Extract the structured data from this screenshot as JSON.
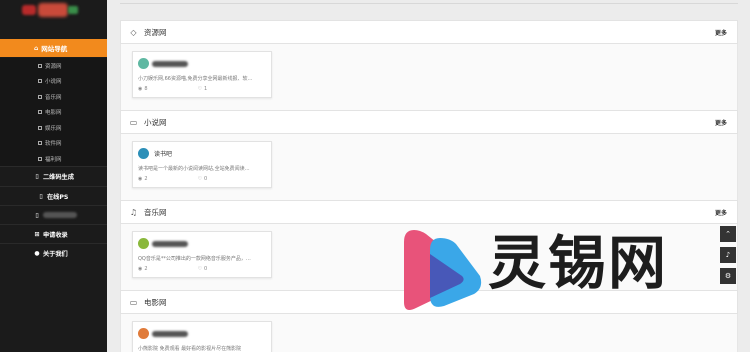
{
  "sidebar": {
    "active_item": {
      "icon": "home-icon",
      "label": "网站导航"
    },
    "subitems": [
      "资源网",
      "小说网",
      "音乐网",
      "电影网",
      "娱乐网",
      "软件网",
      "福利网"
    ],
    "items": [
      {
        "icon": "qrcode-icon",
        "label": "二维码生成"
      },
      {
        "icon": "image-icon",
        "label": "在线PS"
      },
      {
        "icon": "file-icon",
        "label": ""
      },
      {
        "icon": "plus-square-icon",
        "label": "申请收录"
      },
      {
        "icon": "info-icon",
        "label": "关于我们"
      }
    ]
  },
  "sections": [
    {
      "icon": "diamond-icon",
      "title": "资源网",
      "more": "更多",
      "card": {
        "name": "",
        "desc": "小刀娱乐网,66资源喵,免费分享全网最新线报、软…",
        "views": "8",
        "likes": "1"
      }
    },
    {
      "icon": "file-o-icon",
      "title": "小说网",
      "more": "更多",
      "card": {
        "name": "读书吧",
        "desc": "读书吧是一个最新的小说阅读网站,全站免费阅读…",
        "views": "2",
        "likes": "0"
      }
    },
    {
      "icon": "music-icon",
      "title": "音乐网",
      "more": "更多",
      "card": {
        "name": "",
        "desc": "QQ音乐是**公司推出的一款网络音乐服务产品，…",
        "views": "2",
        "likes": "0"
      }
    },
    {
      "icon": "monitor-icon",
      "title": "电影网",
      "more": "",
      "card": {
        "name": "",
        "desc": "小熊影院 免费观看 最好看的影视片尽在熊影院",
        "views": "",
        "likes": ""
      }
    }
  ],
  "float_buttons": [
    "chevron-up-icon",
    "bell-icon",
    "gear-icon"
  ],
  "watermark": {
    "text": "灵锡网"
  },
  "colors": {
    "accent": "#f28a1d",
    "sidebar_bg": "#1b1b1b",
    "wm_pink": "#e8537a",
    "wm_blue": "#3aa7e8"
  }
}
